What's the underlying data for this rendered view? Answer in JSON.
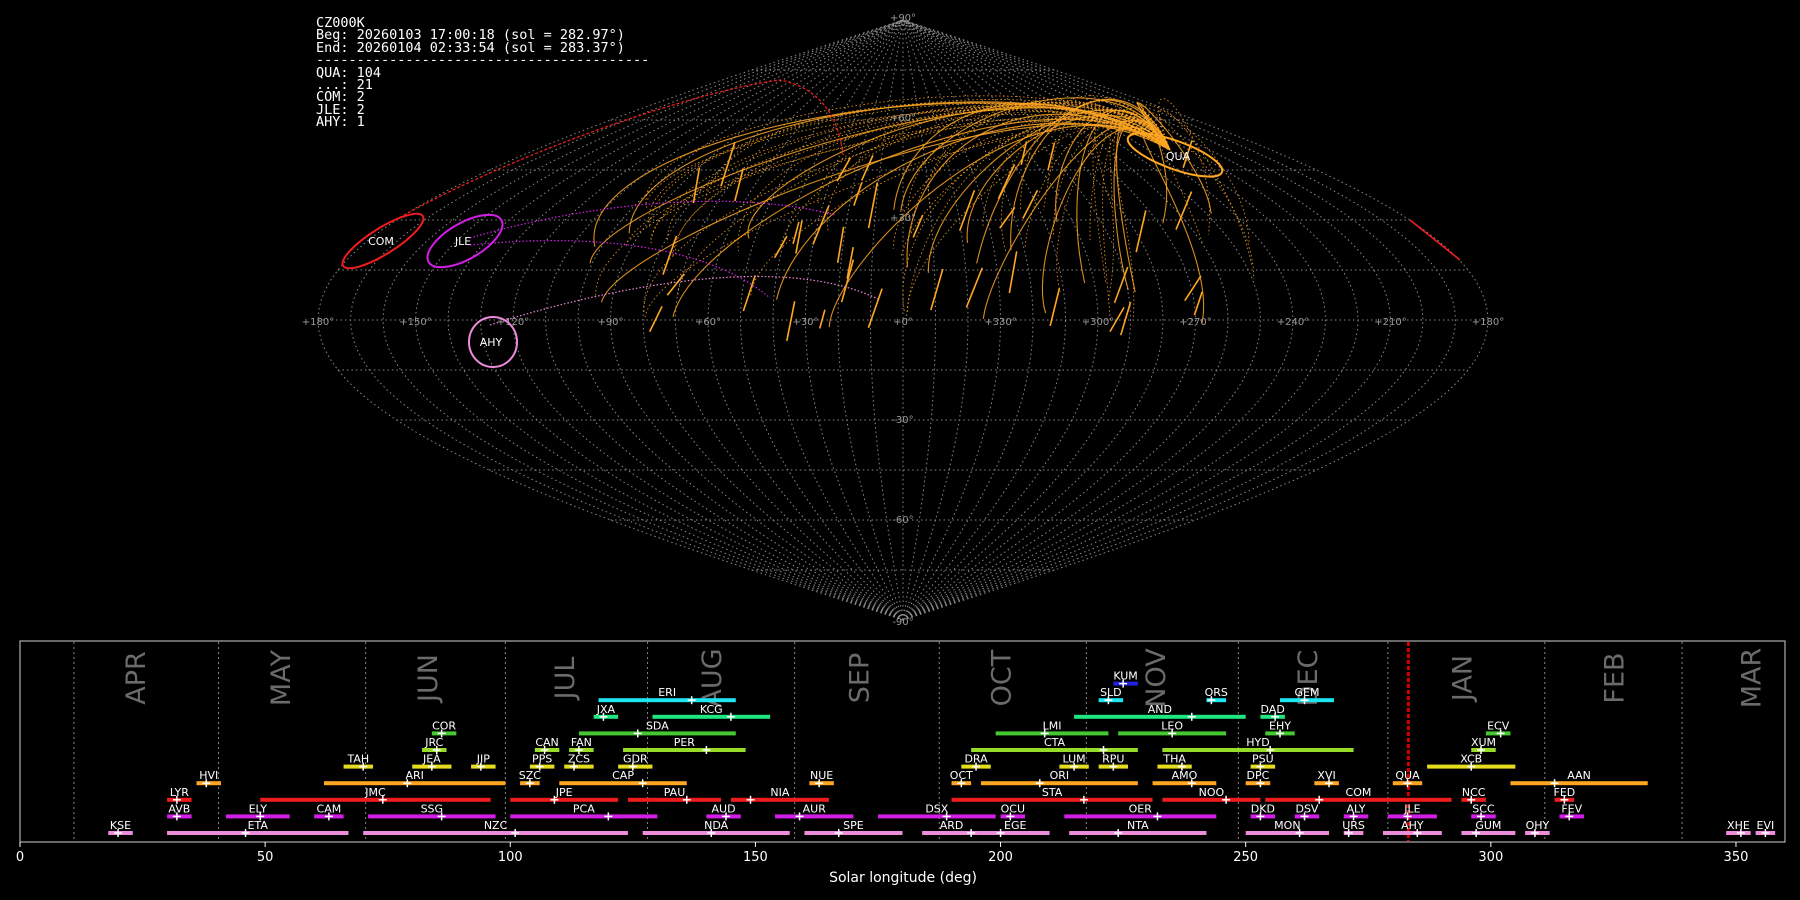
{
  "header": {
    "station": "CZ000K",
    "beg": "Beg: 20260103 17:00:18 (sol = 282.97°)",
    "end": "End: 20260104 02:33:54 (sol = 283.37°)",
    "sep": "-----------------------------------------",
    "counts": [
      "QUA: 104",
      "...: 21",
      "COM: 2",
      "JLE: 2",
      "AHY: 1"
    ]
  },
  "colors": {
    "qua": "#ffa722",
    "com": "#ee1c1c",
    "jle": "#d21ee6",
    "ahy": "#ee8cdc",
    "grid": "#8a8a8a",
    "marker": "#d40000"
  },
  "sky": {
    "lon_labels": [
      "+180°",
      "+150°",
      "+120°",
      "+90°",
      "+60°",
      "+30°",
      "+0°",
      "+330°",
      "+300°",
      "+270°",
      "+240°",
      "+210°",
      "+180°"
    ],
    "lat_labels": [
      "+90°",
      "+60°",
      "+30°",
      "-30°",
      "-60°",
      "-90°"
    ],
    "radiants": [
      {
        "code": "QUA",
        "color": "#ffa722"
      },
      {
        "code": "COM",
        "color": "#ee1c1c"
      },
      {
        "code": "JLE",
        "color": "#d21ee6"
      },
      {
        "code": "AHY",
        "color": "#ee8cdc"
      }
    ]
  },
  "chart_data": {
    "type": "bar",
    "xlabel": "Solar longitude (deg)",
    "xlim": [
      0,
      360
    ],
    "xticks": [
      0,
      50,
      100,
      150,
      200,
      250,
      300,
      350
    ],
    "current_sol": 283.17,
    "months": [
      {
        "name": "APR",
        "sol": 24.0
      },
      {
        "name": "MAY",
        "sol": 53.5
      },
      {
        "name": "JUN",
        "sol": 83.5
      },
      {
        "name": "JUL",
        "sol": 111.5
      },
      {
        "name": "AUG",
        "sol": 141.5
      },
      {
        "name": "SEP",
        "sol": 171.5
      },
      {
        "name": "OCT",
        "sol": 200.5
      },
      {
        "name": "NOV",
        "sol": 232.0
      },
      {
        "name": "DEC",
        "sol": 263.0
      },
      {
        "name": "JAN",
        "sol": 294.5
      },
      {
        "name": "FEB",
        "sol": 325.5
      },
      {
        "name": "MAR",
        "sol": 353.5
      }
    ],
    "month_boundaries": [
      11,
      40.5,
      70.5,
      99,
      128,
      158,
      187.5,
      217.5,
      248.5,
      279,
      311,
      339
    ],
    "showers": [
      {
        "code": "KUM",
        "start": 223,
        "end": 228,
        "peak": 225,
        "row": 9,
        "color": "#2222dd"
      },
      {
        "code": "ERI",
        "start": 118,
        "end": 146,
        "peak": 137,
        "row": 8,
        "color": "#1ee6f0"
      },
      {
        "code": "SLD",
        "start": 220,
        "end": 225,
        "peak": 222,
        "row": 8,
        "color": "#1ee6f0"
      },
      {
        "code": "ORS",
        "start": 242,
        "end": 246,
        "peak": 243,
        "row": 8,
        "color": "#1ee6f0"
      },
      {
        "code": "GEM",
        "start": 257,
        "end": 268,
        "peak": 262,
        "row": 8,
        "color": "#1ee6f0"
      },
      {
        "code": "JXA",
        "start": 117,
        "end": 122,
        "peak": 119,
        "row": 7,
        "color": "#1ee680"
      },
      {
        "code": "KCG",
        "start": 129,
        "end": 153,
        "peak": 145,
        "row": 7,
        "color": "#1ee680"
      },
      {
        "code": "AND",
        "start": 215,
        "end": 250,
        "peak": 239,
        "row": 7,
        "color": "#1ee680"
      },
      {
        "code": "DAD",
        "start": 253,
        "end": 258,
        "peak": 256,
        "row": 7,
        "color": "#1ee680"
      },
      {
        "code": "COR",
        "start": 84,
        "end": 89,
        "peak": 86,
        "row": 6,
        "color": "#46c832"
      },
      {
        "code": "SDA",
        "start": 114,
        "end": 146,
        "peak": 126,
        "row": 6,
        "color": "#46c832"
      },
      {
        "code": "LMI",
        "start": 199,
        "end": 222,
        "peak": 209,
        "row": 6,
        "color": "#46c832"
      },
      {
        "code": "LEO",
        "start": 224,
        "end": 246,
        "peak": 235,
        "row": 6,
        "color": "#46c832"
      },
      {
        "code": "EHY",
        "start": 254,
        "end": 260,
        "peak": 257,
        "row": 6,
        "color": "#46c832"
      },
      {
        "code": "ECV",
        "start": 299,
        "end": 304,
        "peak": 302,
        "row": 6,
        "color": "#46c832"
      },
      {
        "code": "JRC",
        "start": 82,
        "end": 87,
        "peak": 85,
        "row": 5,
        "color": "#96dc28"
      },
      {
        "code": "CAN",
        "start": 105,
        "end": 110,
        "peak": 107,
        "row": 5,
        "color": "#96dc28"
      },
      {
        "code": "FAN",
        "start": 112,
        "end": 117,
        "peak": 114,
        "row": 5,
        "color": "#96dc28"
      },
      {
        "code": "PER",
        "start": 123,
        "end": 148,
        "peak": 140,
        "row": 5,
        "color": "#96dc28"
      },
      {
        "code": "CTA",
        "start": 194,
        "end": 228,
        "peak": 221,
        "row": 5,
        "color": "#96dc28"
      },
      {
        "code": "HYD",
        "start": 233,
        "end": 272,
        "peak": 255,
        "row": 5,
        "color": "#96dc28"
      },
      {
        "code": "XUM",
        "start": 296,
        "end": 301,
        "peak": 298,
        "row": 5,
        "color": "#96dc28"
      },
      {
        "code": "TAH",
        "start": 66,
        "end": 72,
        "peak": 70,
        "row": 4,
        "color": "#e6dc1e"
      },
      {
        "code": "JEA",
        "start": 80,
        "end": 88,
        "peak": 84,
        "row": 4,
        "color": "#e6dc1e"
      },
      {
        "code": "JIP",
        "start": 92,
        "end": 97,
        "peak": 94,
        "row": 4,
        "color": "#e6dc1e"
      },
      {
        "code": "PPS",
        "start": 104,
        "end": 109,
        "peak": 106,
        "row": 4,
        "color": "#e6dc1e"
      },
      {
        "code": "ZCS",
        "start": 111,
        "end": 117,
        "peak": 113,
        "row": 4,
        "color": "#e6dc1e"
      },
      {
        "code": "GDR",
        "start": 122,
        "end": 129,
        "peak": 125,
        "row": 4,
        "color": "#e6dc1e"
      },
      {
        "code": "DRA",
        "start": 192,
        "end": 198,
        "peak": 195,
        "row": 4,
        "color": "#e6dc1e"
      },
      {
        "code": "LUM",
        "start": 212,
        "end": 218,
        "peak": 215,
        "row": 4,
        "color": "#e6dc1e"
      },
      {
        "code": "RPU",
        "start": 220,
        "end": 226,
        "peak": 223,
        "row": 4,
        "color": "#e6dc1e"
      },
      {
        "code": "THA",
        "start": 232,
        "end": 239,
        "peak": 237,
        "row": 4,
        "color": "#e6dc1e"
      },
      {
        "code": "PSU",
        "start": 251,
        "end": 256,
        "peak": 253,
        "row": 4,
        "color": "#e6dc1e"
      },
      {
        "code": "XCB",
        "start": 287,
        "end": 305,
        "peak": 296,
        "row": 4,
        "color": "#e6dc1e"
      },
      {
        "code": "HVI",
        "start": 36,
        "end": 41,
        "peak": 38,
        "row": 3,
        "color": "#ffa722"
      },
      {
        "code": "ARI",
        "start": 62,
        "end": 99,
        "peak": 79,
        "row": 3,
        "color": "#ffa722"
      },
      {
        "code": "SZC",
        "start": 102,
        "end": 106,
        "peak": 104,
        "row": 3,
        "color": "#ffa722"
      },
      {
        "code": "CAP",
        "start": 110,
        "end": 136,
        "peak": 127,
        "row": 3,
        "color": "#ffa722"
      },
      {
        "code": "NUE",
        "start": 161,
        "end": 166,
        "peak": 163,
        "row": 3,
        "color": "#ffa722"
      },
      {
        "code": "OCT",
        "start": 190,
        "end": 194,
        "peak": 192,
        "row": 3,
        "color": "#ffa722"
      },
      {
        "code": "ORI",
        "start": 196,
        "end": 228,
        "peak": 208,
        "row": 3,
        "color": "#ffa722"
      },
      {
        "code": "AMO",
        "start": 231,
        "end": 244,
        "peak": 239,
        "row": 3,
        "color": "#ffa722"
      },
      {
        "code": "DPC",
        "start": 250,
        "end": 255,
        "peak": 253,
        "row": 3,
        "color": "#ffa722"
      },
      {
        "code": "XVI",
        "start": 264,
        "end": 269,
        "peak": 267,
        "row": 3,
        "color": "#ffa722"
      },
      {
        "code": "QUA",
        "start": 280,
        "end": 286,
        "peak": 283,
        "row": 3,
        "color": "#ffa722"
      },
      {
        "code": "AAN",
        "start": 304,
        "end": 332,
        "peak": 313,
        "row": 3,
        "color": "#ffa722"
      },
      {
        "code": "LYR",
        "start": 30,
        "end": 35,
        "peak": 32,
        "row": 2,
        "color": "#ee1c1c"
      },
      {
        "code": "JMC",
        "start": 49,
        "end": 96,
        "peak": 74,
        "row": 2,
        "color": "#ee1c1c"
      },
      {
        "code": "JPE",
        "start": 100,
        "end": 122,
        "peak": 109,
        "row": 2,
        "color": "#ee1c1c"
      },
      {
        "code": "PAU",
        "start": 124,
        "end": 143,
        "peak": 136,
        "row": 2,
        "color": "#ee1c1c"
      },
      {
        "code": "NIA",
        "start": 145,
        "end": 165,
        "peak": 149,
        "row": 2,
        "color": "#ee1c1c"
      },
      {
        "code": "STA",
        "start": 190,
        "end": 231,
        "peak": 217,
        "row": 2,
        "color": "#ee1c1c"
      },
      {
        "code": "NOO",
        "start": 233,
        "end": 253,
        "peak": 246,
        "row": 2,
        "color": "#ee1c1c"
      },
      {
        "code": "COM",
        "start": 254,
        "end": 292,
        "peak": 265,
        "row": 2,
        "color": "#ee1c1c"
      },
      {
        "code": "NCC",
        "start": 294,
        "end": 299,
        "peak": 296,
        "row": 2,
        "color": "#ee1c1c"
      },
      {
        "code": "FED",
        "start": 313,
        "end": 317,
        "peak": 315,
        "row": 2,
        "color": "#ee1c1c"
      },
      {
        "code": "AVB",
        "start": 30,
        "end": 35,
        "peak": 32,
        "row": 1,
        "color": "#d21ee6"
      },
      {
        "code": "ELY",
        "start": 42,
        "end": 55,
        "peak": 49,
        "row": 1,
        "color": "#d21ee6"
      },
      {
        "code": "CAM",
        "start": 60,
        "end": 66,
        "peak": 63,
        "row": 1,
        "color": "#d21ee6"
      },
      {
        "code": "SSG",
        "start": 71,
        "end": 97,
        "peak": 86,
        "row": 1,
        "color": "#d21ee6"
      },
      {
        "code": "PCA",
        "start": 100,
        "end": 130,
        "peak": 120,
        "row": 1,
        "color": "#d21ee6"
      },
      {
        "code": "AUD",
        "start": 140,
        "end": 147,
        "peak": 144,
        "row": 1,
        "color": "#d21ee6"
      },
      {
        "code": "AUR",
        "start": 154,
        "end": 170,
        "peak": 159,
        "row": 1,
        "color": "#d21ee6"
      },
      {
        "code": "DSX",
        "start": 175,
        "end": 199,
        "peak": 189,
        "row": 1,
        "color": "#d21ee6"
      },
      {
        "code": "OCU",
        "start": 200,
        "end": 205,
        "peak": 202,
        "row": 1,
        "color": "#d21ee6"
      },
      {
        "code": "OER",
        "start": 213,
        "end": 244,
        "peak": 232,
        "row": 1,
        "color": "#d21ee6"
      },
      {
        "code": "DKD",
        "start": 251,
        "end": 256,
        "peak": 253,
        "row": 1,
        "color": "#d21ee6"
      },
      {
        "code": "DSV",
        "start": 260,
        "end": 265,
        "peak": 262,
        "row": 1,
        "color": "#d21ee6"
      },
      {
        "code": "ALY",
        "start": 270,
        "end": 275,
        "peak": 272,
        "row": 1,
        "color": "#d21ee6"
      },
      {
        "code": "JLE",
        "start": 279,
        "end": 289,
        "peak": 283,
        "row": 1,
        "color": "#d21ee6"
      },
      {
        "code": "SCC",
        "start": 296,
        "end": 301,
        "peak": 298,
        "row": 1,
        "color": "#d21ee6"
      },
      {
        "code": "FEV",
        "start": 314,
        "end": 319,
        "peak": 316,
        "row": 1,
        "color": "#d21ee6"
      },
      {
        "code": "KSE",
        "start": 18,
        "end": 23,
        "peak": 20,
        "row": 0,
        "color": "#ee8cdc"
      },
      {
        "code": "ETA",
        "start": 30,
        "end": 67,
        "peak": 46,
        "row": 0,
        "color": "#ee8cdc"
      },
      {
        "code": "NZC",
        "start": 70,
        "end": 124,
        "peak": 101,
        "row": 0,
        "color": "#ee8cdc"
      },
      {
        "code": "NDA",
        "start": 127,
        "end": 157,
        "peak": 141,
        "row": 0,
        "color": "#ee8cdc"
      },
      {
        "code": "SPE",
        "start": 160,
        "end": 180,
        "peak": 167,
        "row": 0,
        "color": "#ee8cdc"
      },
      {
        "code": "ARD",
        "start": 184,
        "end": 196,
        "peak": 194,
        "row": 0,
        "color": "#ee8cdc"
      },
      {
        "code": "EGE",
        "start": 196,
        "end": 210,
        "peak": 200,
        "row": 0,
        "color": "#ee8cdc"
      },
      {
        "code": "NTA",
        "start": 214,
        "end": 242,
        "peak": 224,
        "row": 0,
        "color": "#ee8cdc"
      },
      {
        "code": "MON",
        "start": 250,
        "end": 267,
        "peak": 261,
        "row": 0,
        "color": "#ee8cdc"
      },
      {
        "code": "URS",
        "start": 270,
        "end": 274,
        "peak": 271,
        "row": 0,
        "color": "#ee8cdc"
      },
      {
        "code": "AHY",
        "start": 278,
        "end": 290,
        "peak": 285,
        "row": 0,
        "color": "#ee8cdc"
      },
      {
        "code": "GUM",
        "start": 294,
        "end": 305,
        "peak": 297,
        "row": 0,
        "color": "#ee8cdc"
      },
      {
        "code": "OHY",
        "start": 307,
        "end": 312,
        "peak": 309,
        "row": 0,
        "color": "#ee8cdc"
      },
      {
        "code": "XHE",
        "start": 348,
        "end": 353,
        "peak": 351,
        "row": 0,
        "color": "#ee8cdc"
      },
      {
        "code": "EVI",
        "start": 354,
        "end": 358,
        "peak": 356,
        "row": 0,
        "color": "#ee8cdc"
      }
    ]
  }
}
